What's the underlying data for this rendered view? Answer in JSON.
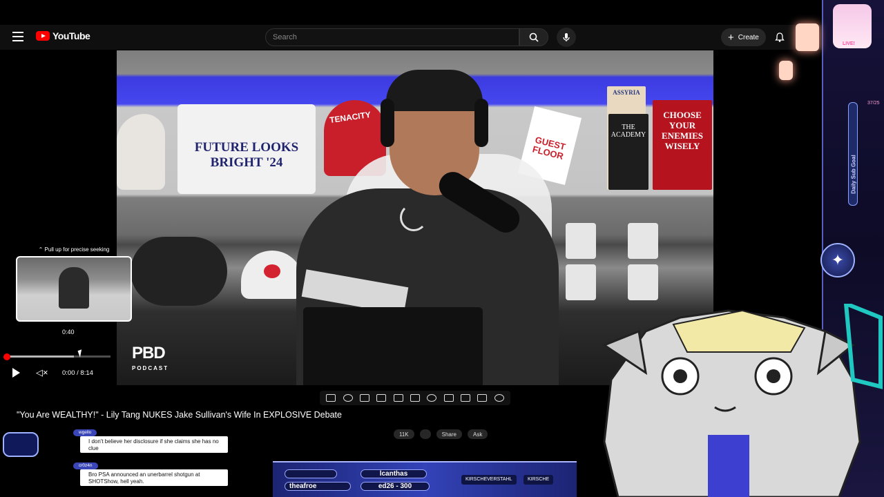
{
  "header": {
    "logo_text": "YouTube",
    "search_placeholder": "Search",
    "create_label": "Create"
  },
  "player": {
    "seek_hint": "Pull up for precise seeking",
    "preview_time": "0:40",
    "time_display": "0:00 / 8:14",
    "progress_fraction": 0.0,
    "hover_fraction": 0.0809,
    "video_overlay_logo": "PBD",
    "video_overlay_sub": "PODCAST",
    "shirt_text_line1": "FUTURE LOOKS",
    "shirt_text_line2": "BRIGHT '24",
    "helmet_text": "TENACITY",
    "badge_text_line1": "GUEST",
    "badge_text_line2": "FLOOR",
    "books": [
      "ASSYRIA",
      "THE ACADEMY",
      "CHOOSE YOUR ENEMIES WISELY"
    ]
  },
  "video": {
    "title": "\"You Are WEALTHY!\" - Lily Tang NUKES Jake Sullivan's Wife In EXPLOSIVE Debate",
    "actions": [
      "11K",
      "",
      "Share",
      "Ask"
    ]
  },
  "overlay": {
    "live_label": "LIVE!",
    "goal_label": "Daily Sub Goal",
    "goal_count": "37/25",
    "chips": [
      "lcanthas",
      "theafroe",
      "ed26 - 300"
    ],
    "tags": [
      "KIRSCHEVERSTAHL",
      "KIRSCHE"
    ]
  },
  "chat": [
    {
      "name": "wgello",
      "text": "I don't believe her disclosure if she claims she has no clue"
    },
    {
      "name": "cr0z4n",
      "text": "Bro PSA announced an unerbarrel shotgun at SHOTShow, hell yeah."
    }
  ],
  "colors": {
    "youtube_red": "#ff0000",
    "overlay_blue": "#3343b8",
    "accent_pink": "#ff4fa0"
  }
}
